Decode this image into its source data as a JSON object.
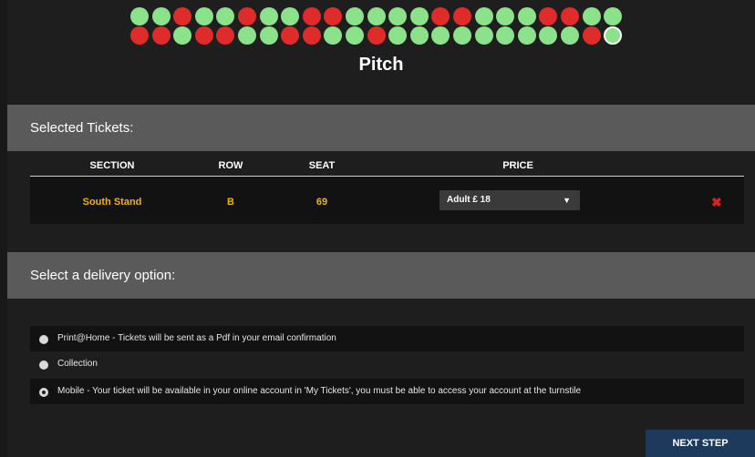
{
  "seat_map": {
    "row1": [
      "avail",
      "avail",
      "taken",
      "avail",
      "avail",
      "taken",
      "avail",
      "avail",
      "taken",
      "taken",
      "avail",
      "avail",
      "avail",
      "avail",
      "taken",
      "taken",
      "avail",
      "avail",
      "avail",
      "taken",
      "taken",
      "avail",
      "avail"
    ],
    "row2": [
      "taken",
      "taken",
      "avail",
      "taken",
      "taken",
      "avail",
      "avail",
      "taken",
      "taken",
      "avail",
      "avail",
      "taken",
      "avail",
      "avail",
      "avail",
      "avail",
      "avail",
      "avail",
      "avail",
      "avail",
      "avail",
      "taken",
      "selected"
    ],
    "pitch_label": "Pitch",
    "colors": {
      "available": "#8be28b",
      "taken": "#e02b2b"
    }
  },
  "tickets": {
    "header": "Selected Tickets:",
    "columns": [
      "SECTION",
      "ROW",
      "SEAT",
      "PRICE"
    ],
    "rows": [
      {
        "section": "South Stand",
        "row": "B",
        "seat": "69",
        "price": "Adult £ 18"
      }
    ],
    "remove_icon": "close-icon"
  },
  "delivery": {
    "header": "Select a delivery option:",
    "options": [
      {
        "label": "Print@Home - Tickets will be sent as a Pdf in your email confirmation",
        "checked": false
      },
      {
        "label": "Collection",
        "checked": false
      },
      {
        "label": "Mobile - Your ticket will be available in your online account in 'My Tickets', you must be able to access your account at the turnstile",
        "checked": true
      }
    ]
  },
  "next_button": "NEXT STEP"
}
